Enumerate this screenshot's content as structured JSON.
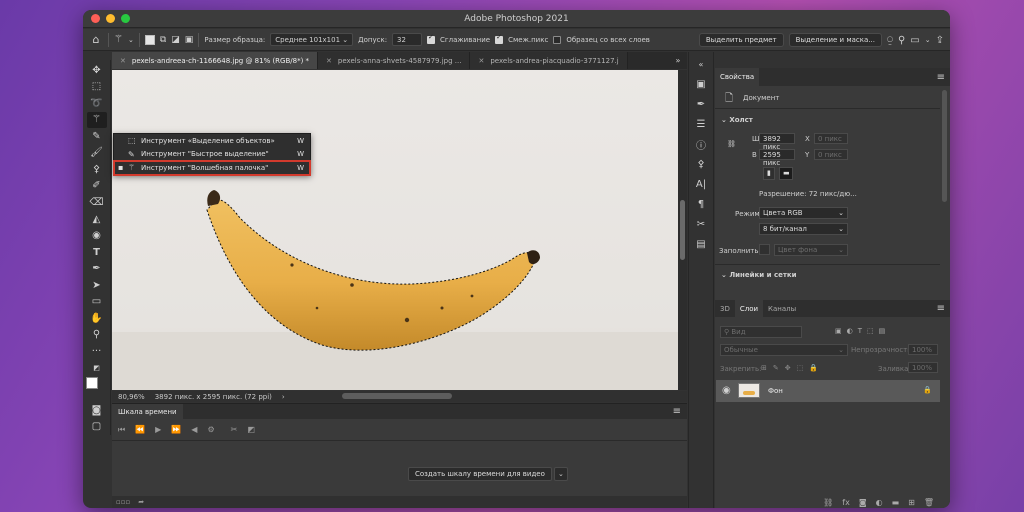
{
  "window": {
    "title": "Adobe Photoshop 2021"
  },
  "optionsbar": {
    "sample_size_label": "Размер образца:",
    "sample_size_value": "Среднее 101x101",
    "tolerance_label": "Допуск:",
    "tolerance_value": "32",
    "antialias_label": "Сглаживание",
    "contiguous_label": "Смеж.пикс",
    "sample_all_label": "Образец со всех слоев",
    "select_subject": "Выделить предмет",
    "select_mask": "Выделение и маска..."
  },
  "tabs": [
    {
      "label": "pexels-andreea-ch-1166648.jpg @ 81% (RGB/8*) *"
    },
    {
      "label": "pexels-anna-shvets-4587979.jpg ..."
    },
    {
      "label": "pexels-andrea-piacquadio-3771127.j"
    }
  ],
  "flyout": {
    "items": [
      {
        "label": "Инструмент «Выделение объектов»",
        "key": "W"
      },
      {
        "label": "Инструмент \"Быстрое выделение\"",
        "key": "W"
      },
      {
        "label": "Инструмент \"Волшебная палочка\"",
        "key": "W"
      }
    ]
  },
  "status": {
    "zoom": "80,96%",
    "dims": "3892 пикс. x 2595 пикс. (72 ppi)",
    "arrow": "›"
  },
  "timeline": {
    "tab": "Шкала времени",
    "create_button": "Создать шкалу времени для видео"
  },
  "properties": {
    "tab": "Свойства",
    "doc_label": "Документ",
    "canvas_section": "Холст",
    "w_label": "Ш",
    "w_value": "3892 пикс",
    "x_label": "X",
    "x_value": "0 пикс",
    "h_label": "В",
    "h_value": "2595 пикс",
    "y_label": "Y",
    "y_value": "0 пикс",
    "resolution": "Разрешение: 72 пикс/дю...",
    "mode_label": "Режим",
    "mode_value": "Цвета RGB",
    "bits_value": "8 бит/канал",
    "fill_label": "Заполнить",
    "fill_value": "Цвет фона",
    "rulers_section": "Линейки и сетки"
  },
  "layers": {
    "tabs": [
      "3D",
      "Слои",
      "Каналы"
    ],
    "kind_value": "Вид",
    "blend_value": "Обычные",
    "opacity_label": "Непрозрачность:",
    "opacity_value": "100%",
    "lock_label": "Закрепить:",
    "fill_label": "Заливка:",
    "fill_value": "100%",
    "layer_name": "Фон"
  },
  "colors": {
    "accent": "#d23a2d",
    "panel": "#3a3a3a",
    "banana": "#e9b64a"
  }
}
